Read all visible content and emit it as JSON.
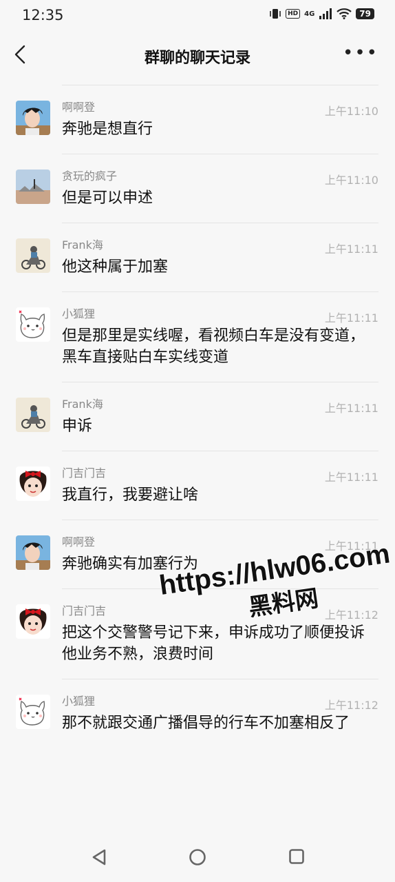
{
  "status": {
    "time": "12:35",
    "battery": "79",
    "network": "4G",
    "hd": "HD"
  },
  "header": {
    "title": "群聊的聊天记录"
  },
  "messages": [
    {
      "name": "啊啊登",
      "time": "上午11:10",
      "text": "奔驰是想直行",
      "avatar": "boy-cartoon-avatar"
    },
    {
      "name": "贪玩的疯子",
      "time": "上午11:10",
      "text": "但是可以申述",
      "avatar": "landscape-avatar"
    },
    {
      "name": "Frank海",
      "time": "上午11:11",
      "text": "他这种属于加塞",
      "avatar": "scooter-sketch-avatar"
    },
    {
      "name": "小狐狸",
      "time": "上午11:11",
      "text": "但是那里是实线喔，看视频白车是没有变道，黑车直接贴白车实线变道",
      "avatar": "cat-doodle-avatar"
    },
    {
      "name": "Frank海",
      "time": "上午11:11",
      "text": "申诉",
      "avatar": "scooter-sketch-avatar"
    },
    {
      "name": "门吉门吉",
      "time": "上午11:11",
      "text": "我直行，我要避让啥",
      "avatar": "girl-bow-avatar"
    },
    {
      "name": "啊啊登",
      "time": "上午11:11",
      "text": "奔驰确实有加塞行为",
      "avatar": "boy-cartoon-avatar"
    },
    {
      "name": "门吉门吉",
      "time": "上午11:12",
      "text": "把这个交警警号记下来，申诉成功了顺便投诉他业务不熟，浪费时间",
      "avatar": "girl-bow-avatar"
    },
    {
      "name": "小狐狸",
      "time": "上午11:12",
      "text": "那不就跟交通广播倡导的行车不加塞相反了",
      "avatar": "cat-doodle-avatar"
    }
  ],
  "watermark": {
    "url": "https://hlw06.com",
    "label": "黑料网"
  },
  "colors": {
    "background": "#f7f7f7",
    "divider": "#e4e4e4",
    "name": "#888888",
    "timestamp": "#b2b2b2"
  },
  "nav": {
    "icons": [
      "back-triangle-icon",
      "home-circle-icon",
      "recents-square-icon"
    ]
  }
}
